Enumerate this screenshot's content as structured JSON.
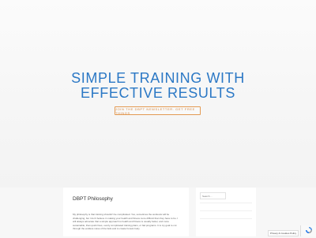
{
  "hero": {
    "title_line1": "SIMPLE TRAINING WITH",
    "title_line2": "EFFECTIVE RESULTS",
    "cta_label": "JOIN THE DBPT NEWSLETTER. GET FREE THINGS"
  },
  "post": {
    "title": "DBPT Philosophy",
    "body": "My philosophy is that training shouldn't be complicated. Yes, sometimes the workouts will be challenging, but I don't believe in making your health and fitness more difficult than they have to be. I will always advocate that a simple approach to health and fitness is usually better, and more sustainable, than quick fixes, overly complicated training plans, or fad programs. It is my goal to cut through the endless noise of the fads and to create honest body"
  },
  "sidebar": {
    "search_placeholder": "Search ..."
  },
  "privacy": {
    "label": "Privacy & Cookies Policy"
  },
  "recaptcha": {
    "icon": "recaptcha-icon"
  },
  "colors": {
    "hero_title": "#2b78c5",
    "cta_border": "#e39a52"
  }
}
